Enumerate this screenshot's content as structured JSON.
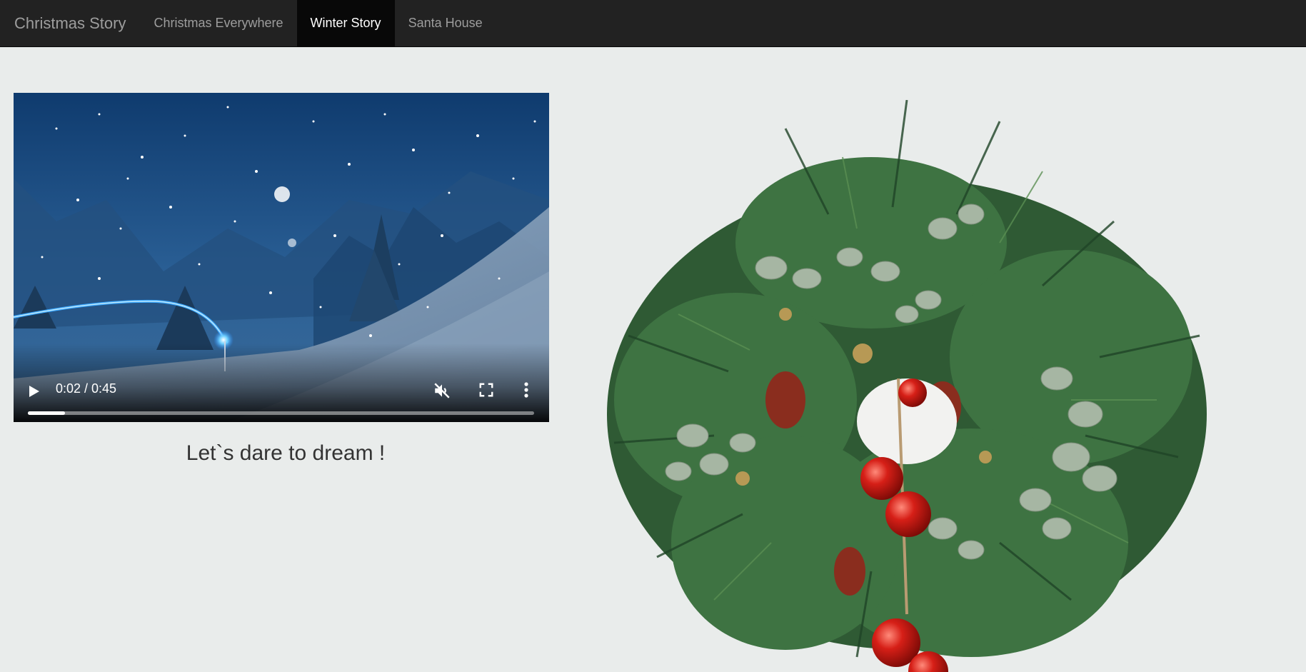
{
  "navbar": {
    "brand": "Christmas Story",
    "items": [
      {
        "label": "Christmas Everywhere",
        "active": false
      },
      {
        "label": "Winter Story",
        "active": true
      },
      {
        "label": "Santa House",
        "active": false
      }
    ]
  },
  "video": {
    "time": "0:02 / 0:45",
    "progress": 0.074,
    "muted": true,
    "icons": [
      "play-icon",
      "mute-icon",
      "fullscreen-icon",
      "more-options-icon"
    ]
  },
  "tagline": "Let`s dare to dream !",
  "colors": {
    "navbar_bg": "#222222",
    "nav_active_bg": "#080808",
    "page_bg": "#e9eceb",
    "text": "#333333"
  }
}
